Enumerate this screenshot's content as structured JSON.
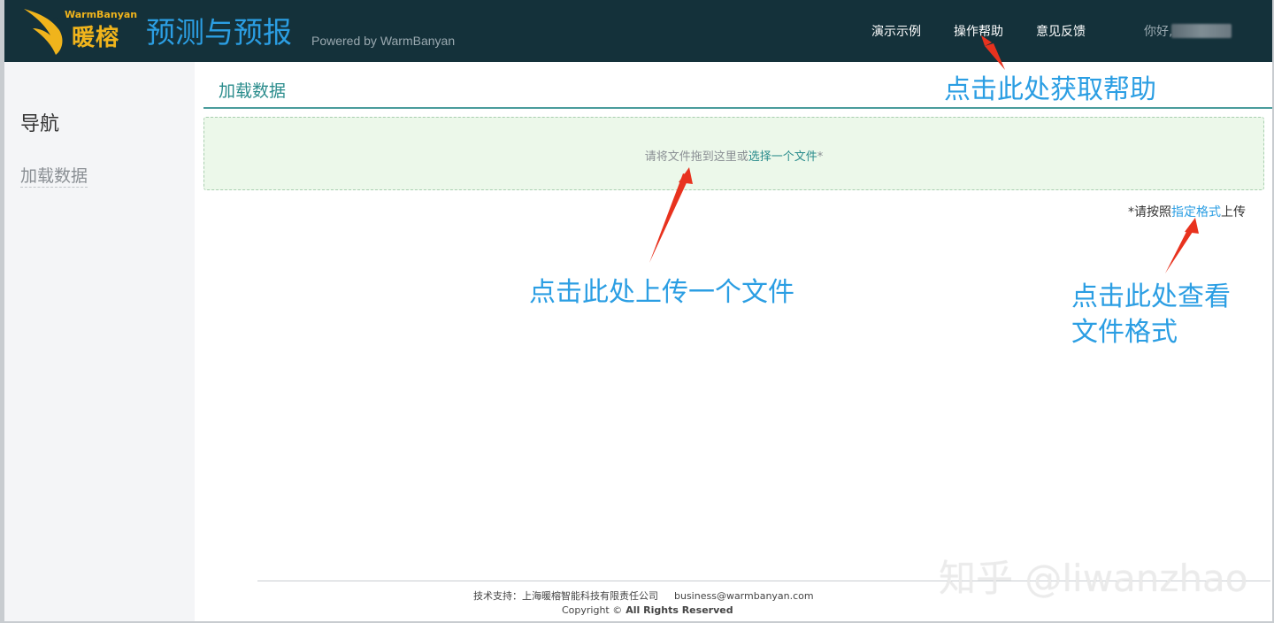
{
  "header": {
    "logo_en": "WarmBanyan",
    "logo_cn": "暖榕",
    "title": "预测与预报",
    "powered": "Powered by WarmBanyan",
    "nav": [
      "演示示例",
      "操作帮助",
      "意见反馈"
    ],
    "greeting": "你好,"
  },
  "sidebar": {
    "title": "导航",
    "items": [
      {
        "label": "加载数据"
      }
    ]
  },
  "main": {
    "section_title": "加载数据",
    "dropzone": {
      "prefix": "请将文件拖到这里或",
      "link": "选择一个文件",
      "suffix": "*"
    },
    "format_note": {
      "prefix": "*请按照",
      "link": "指定格式",
      "suffix": "上传"
    }
  },
  "annotations": {
    "help": "点击此处获取帮助",
    "upload": "点击此处上传一个文件",
    "format_line1": "点击此处查看",
    "format_line2": "文件格式"
  },
  "footer": {
    "support": "技术支持：上海暖榕智能科技有限责任公司",
    "email": "business@warmbanyan.com",
    "copyright": "Copyright ©",
    "rights": "All Rights Reserved"
  },
  "watermark": "知乎 @liwanzhao",
  "colors": {
    "header_bg": "#14313a",
    "accent_blue": "#2b9ee3",
    "accent_teal": "#2a8c8c",
    "logo_gold": "#f0b41c",
    "dropzone_bg": "#ecf8ea",
    "arrow_red": "#e8321e"
  }
}
